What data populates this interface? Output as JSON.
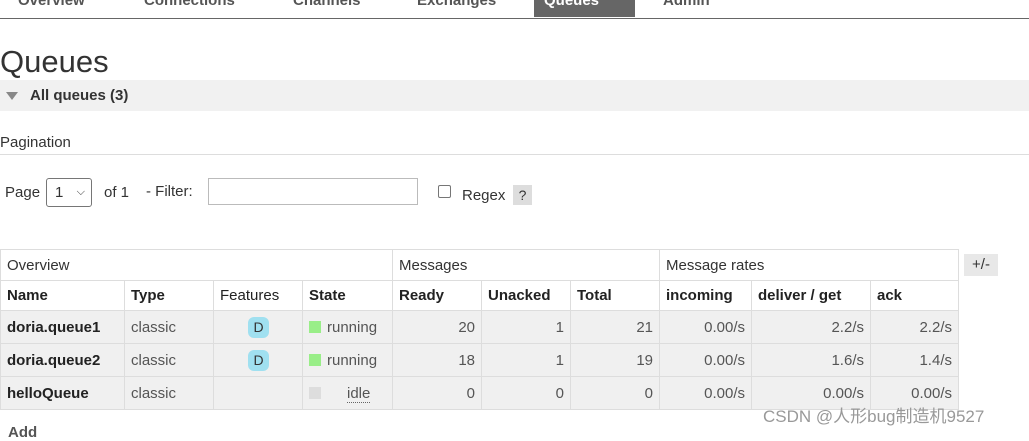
{
  "nav": {
    "tabs": [
      {
        "label": "Overview"
      },
      {
        "label": "Connections"
      },
      {
        "label": "Channels"
      },
      {
        "label": "Exchanges"
      },
      {
        "label": "Queues"
      },
      {
        "label": "Admin"
      }
    ],
    "active": "Queues"
  },
  "page": {
    "title": "Queues"
  },
  "section": {
    "label": "All queues (3)"
  },
  "pagination": {
    "label": "Pagination",
    "page_label": "Page",
    "page_value": "1",
    "of_label": "of 1",
    "filter_label": "- Filter:",
    "filter_value": "",
    "regex_label": "Regex",
    "regex_checked": false,
    "help_label": "?"
  },
  "table": {
    "groups": {
      "overview": "Overview",
      "messages": "Messages",
      "rates": "Message rates"
    },
    "columns": [
      "Name",
      "Type",
      "Features",
      "State",
      "Ready",
      "Unacked",
      "Total",
      "incoming",
      "deliver / get",
      "ack"
    ],
    "rows": [
      {
        "name": "doria.queue1",
        "type": "classic",
        "feature": "D",
        "state": "running",
        "ready": "20",
        "unacked": "1",
        "total": "21",
        "incoming": "0.00/s",
        "deliver_get": "2.2/s",
        "ack": "2.2/s"
      },
      {
        "name": "doria.queue2",
        "type": "classic",
        "feature": "D",
        "state": "running",
        "ready": "18",
        "unacked": "1",
        "total": "19",
        "incoming": "0.00/s",
        "deliver_get": "1.6/s",
        "ack": "1.4/s"
      },
      {
        "name": "helloQueue",
        "type": "classic",
        "feature": "",
        "state": "idle",
        "ready": "0",
        "unacked": "0",
        "total": "0",
        "incoming": "0.00/s",
        "deliver_get": "0.00/s",
        "ack": "0.00/s"
      }
    ],
    "toggle_label": "+/-"
  },
  "add_section": {
    "label": "Add"
  },
  "watermark": "CSDN @人形bug制造机9527",
  "colors": {
    "running": "#99ee88",
    "idle": "#dddddd",
    "feature_badge": "#a0e0f0",
    "active_tab": "#666666"
  }
}
